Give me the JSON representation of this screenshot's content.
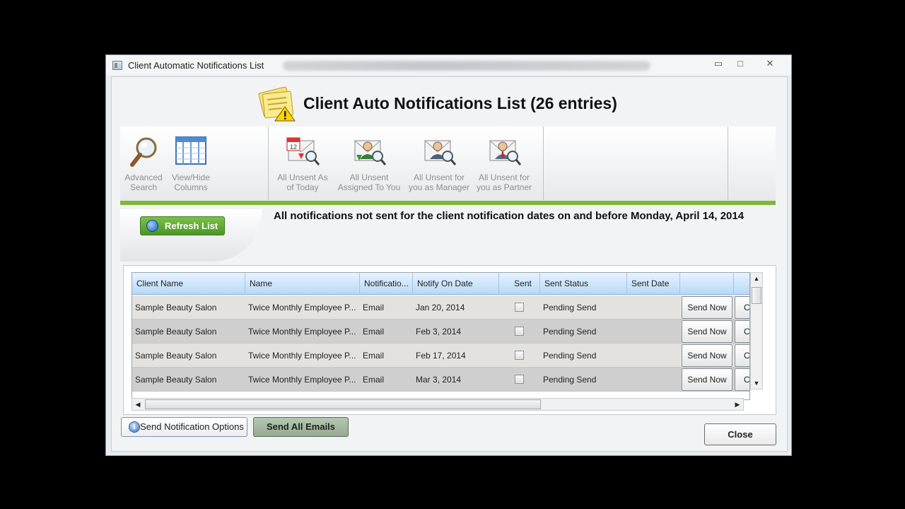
{
  "window": {
    "title": "Client Automatic Notifications List",
    "controls": {
      "minimize": "▭",
      "maximize": "□",
      "close": "✕"
    }
  },
  "header": {
    "icon": "notes-warning-icon",
    "title": "Client Auto Notifications List (26 entries)"
  },
  "ribbon": {
    "buttons": [
      {
        "icon": "magnifier-icon",
        "line1": "Advanced",
        "line2": "Search"
      },
      {
        "icon": "columns-grid-icon",
        "line1": "View/Hide",
        "line2": "Columns"
      },
      {
        "icon": "calendar-mail-icon",
        "line1": "All Unsent As",
        "line2": "of Today"
      },
      {
        "icon": "assigned-user-mail-icon",
        "line1": "All Unsent",
        "line2": "Assigned To You"
      },
      {
        "icon": "manager-mail-icon",
        "line1": "All Unsent for",
        "line2": "you as Manager"
      },
      {
        "icon": "partner-mail-icon",
        "line1": "All Unsent for",
        "line2": "you as Partner"
      }
    ]
  },
  "refresh": {
    "label": "Refresh List",
    "icon": "globe-refresh-icon"
  },
  "notice": "All notifications not sent for the client notification dates on and before Monday, April 14, 2014",
  "table": {
    "columns": [
      "Client Name",
      "Name",
      "Notificatio...",
      "Notify On Date",
      "Sent",
      "Sent Status",
      "Sent Date",
      "",
      ""
    ],
    "rows": [
      {
        "client": "Sample Beauty Salon",
        "name": "Twice Monthly Employee P...",
        "type": "Email",
        "notify_date": "Jan 20, 2014",
        "sent": false,
        "status": "Pending Send",
        "sent_date": "",
        "action1": "Send Now",
        "action2": "Ca"
      },
      {
        "client": "Sample Beauty Salon",
        "name": "Twice Monthly Employee P...",
        "type": "Email",
        "notify_date": "Feb 3, 2014",
        "sent": false,
        "status": "Pending Send",
        "sent_date": "",
        "action1": "Send Now",
        "action2": "Ca"
      },
      {
        "client": "Sample Beauty Salon",
        "name": "Twice Monthly Employee P...",
        "type": "Email",
        "notify_date": "Feb 17, 2014",
        "sent": false,
        "status": "Pending Send",
        "sent_date": "",
        "action1": "Send Now",
        "action2": "Ca"
      },
      {
        "client": "Sample Beauty Salon",
        "name": "Twice Monthly Employee P...",
        "type": "Email",
        "notify_date": "Mar 3, 2014",
        "sent": false,
        "status": "Pending Send",
        "sent_date": "",
        "action1": "Send Now",
        "action2": "Ca"
      }
    ]
  },
  "footer": {
    "options_label": "Send Notification Options",
    "options_icon": "info-icon",
    "options_icon_glyph": "i",
    "send_all_label": "Send All Emails",
    "close_label": "Close"
  }
}
